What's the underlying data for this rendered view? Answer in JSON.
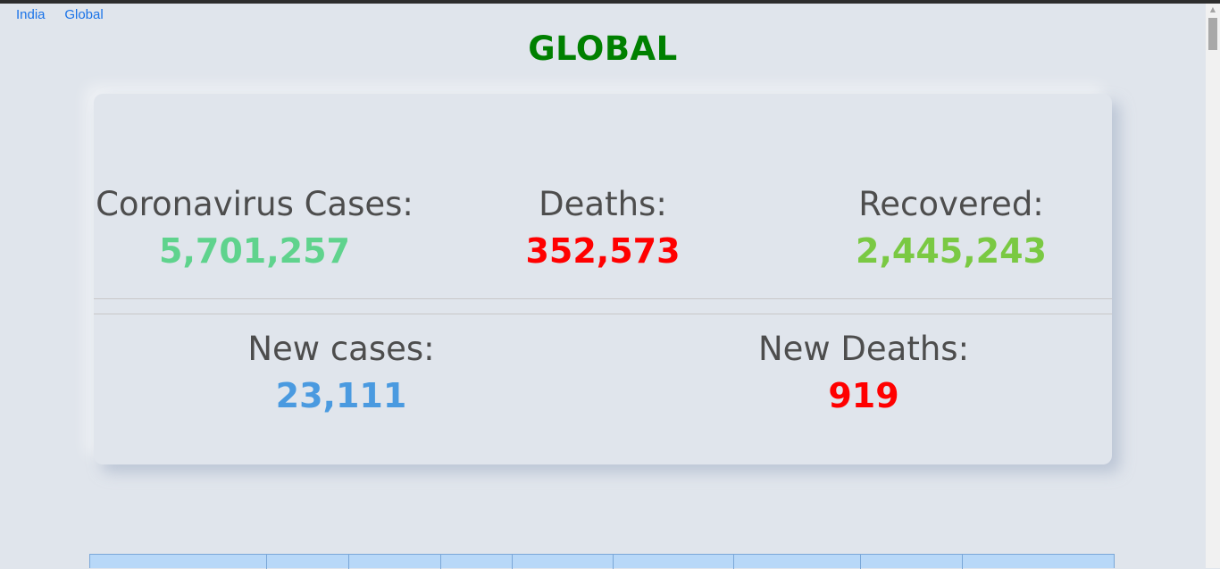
{
  "nav": {
    "india": "India",
    "global": "Global"
  },
  "title": "GLOBAL",
  "stats": {
    "cases_label": "Coronavirus Cases:",
    "cases_value": "5,701,257",
    "deaths_label": "Deaths:",
    "deaths_value": "352,573",
    "recovered_label": "Recovered:",
    "recovered_value": "2,445,243",
    "new_cases_label": "New cases:",
    "new_cases_value": "23,111",
    "new_deaths_label": "New Deaths:",
    "new_deaths_value": "919"
  },
  "colors": {
    "title": "#008000",
    "cases": "#5fd38d",
    "deaths": "#ff0000",
    "recovered": "#7ac943",
    "new_cases": "#4a9ae0",
    "new_deaths": "#ff0000"
  },
  "icons": {
    "scroll_up": "scroll-up-arrow-icon"
  }
}
